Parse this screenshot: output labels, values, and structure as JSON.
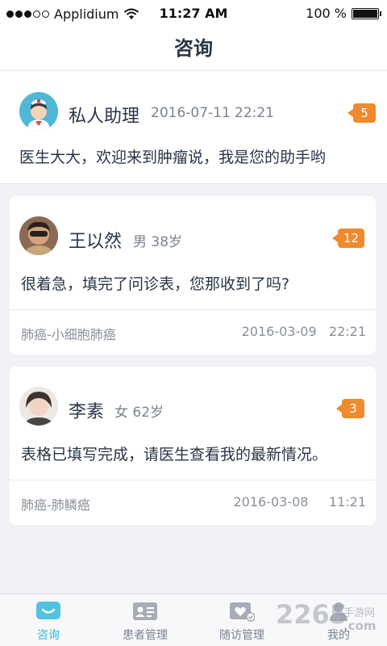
{
  "status_bar": {
    "carrier": "Applidium",
    "time": "11:27 AM",
    "battery": "100 %"
  },
  "header": {
    "title": "咨询"
  },
  "assistant": {
    "name": "私人助理",
    "date": "2016-07-11",
    "time": "22:21",
    "badge": "5",
    "message": "医生大大，欢迎来到肿瘤说，我是您的助手哟"
  },
  "conversations": [
    {
      "name": "王以然",
      "gender_age": "男 38岁",
      "badge": "12",
      "message": "很着急，填完了问诊表，您那收到了吗?",
      "diagnosis": "肺癌-小细胞肺癌",
      "date": "2016-03-09",
      "time": "22:21"
    },
    {
      "name": "李素",
      "gender_age": "女 62岁",
      "badge": "3",
      "message": "表格已填写完成，请医生查看我的最新情况。",
      "diagnosis": "肺癌-肺鳞癌",
      "date": "2016-03-08",
      "time": "11:21"
    }
  ],
  "tabbar": {
    "items": [
      {
        "label": "咨询",
        "icon": "chat-icon",
        "active": true
      },
      {
        "label": "患者管理",
        "icon": "patient-card-icon",
        "active": false
      },
      {
        "label": "随访管理",
        "icon": "follow-up-heart-icon",
        "active": false
      },
      {
        "label": "我的",
        "icon": "profile-icon",
        "active": false
      }
    ]
  },
  "watermark": {
    "number": "2265",
    "text": "手游网",
    "domain": ".com"
  },
  "colors": {
    "accent": "#2fb8d8",
    "badge": "#f08a2e",
    "text": "#2a3547"
  }
}
